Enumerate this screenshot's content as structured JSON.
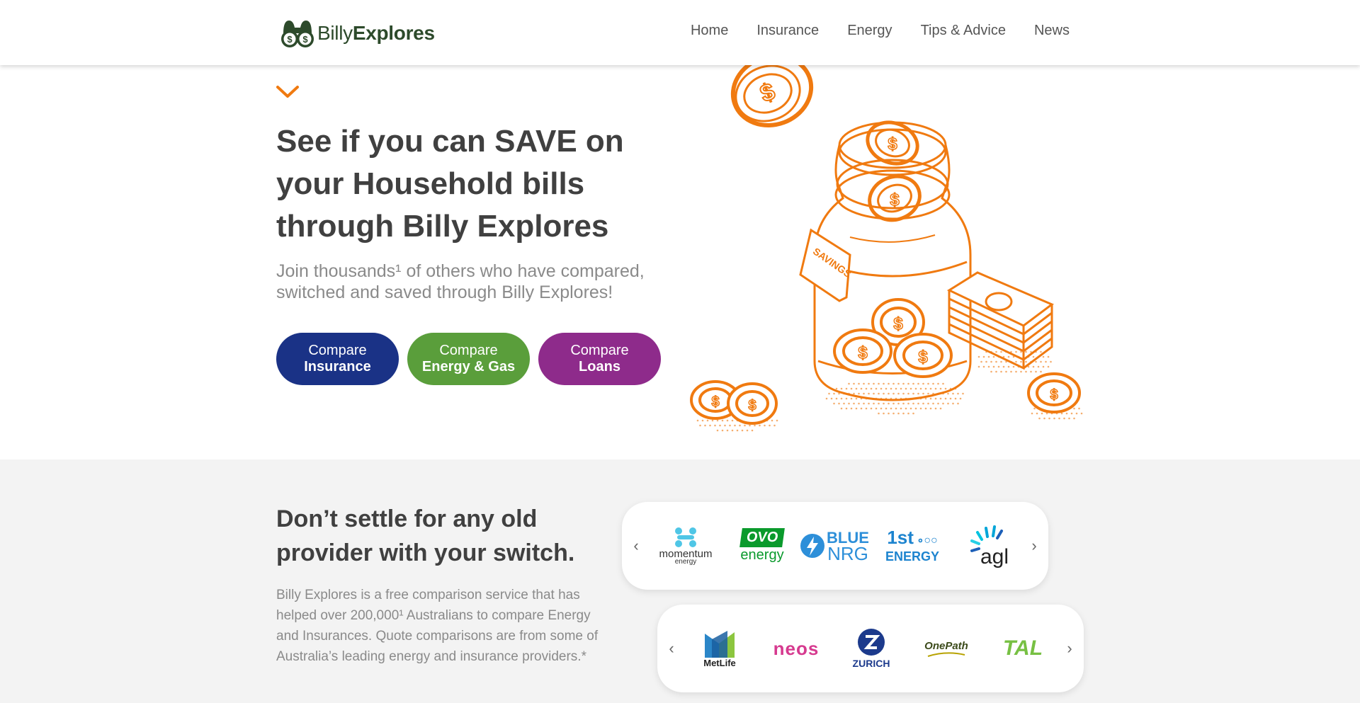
{
  "header": {
    "logo": {
      "part1": "Billy",
      "part2": "Explores",
      "icon": "binoculars-dollar-icon"
    },
    "nav": [
      "Home",
      "Insurance",
      "Energy",
      "Tips & Advice",
      "News"
    ]
  },
  "hero": {
    "title": "See if you can SAVE on your Household bills through Billy Explores",
    "subtitle": "Join thousands¹ of others who have compared, switched and saved through Billy Explores!",
    "buttons": [
      {
        "line1": "Compare",
        "line2": "Insurance",
        "color": "#1a3286"
      },
      {
        "line1": "Compare",
        "line2": "Energy & Gas",
        "color": "#5a9e3b"
      },
      {
        "line1": "Compare",
        "line2": "Loans",
        "color": "#8e2b8b"
      }
    ],
    "illustration": {
      "jar_label": "SAVINGS",
      "accent": "#f07a10"
    }
  },
  "providers": {
    "title": "Don’t settle for any old provider with your switch.",
    "text": "Billy Explores is a free comparison service that has helped over 200,000¹ Australians to compare Energy and Insurances. Quote comparisons are from some of Australia’s leading energy and insurance providers.*",
    "energy_brands": [
      {
        "name": "momentum",
        "sub": "energy"
      },
      {
        "name": "energy",
        "badge": "OVO"
      },
      {
        "name": "BLUE",
        "sub": "NRG"
      },
      {
        "name": "1st",
        "sub": "ENERGY"
      },
      {
        "name": "agl"
      }
    ],
    "insurance_brands": [
      {
        "name": "MetLife"
      },
      {
        "name": "neos"
      },
      {
        "name": "ZURICH"
      },
      {
        "name": "OnePath"
      },
      {
        "name": "TAL"
      }
    ]
  }
}
